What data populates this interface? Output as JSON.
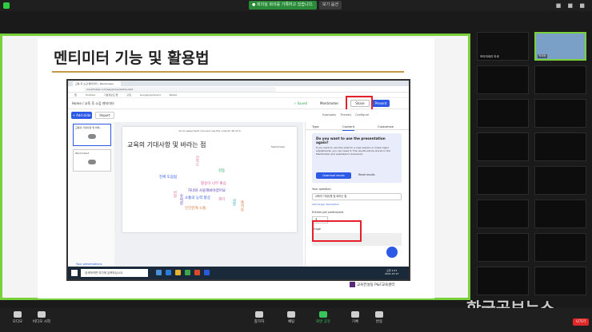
{
  "zoom": {
    "recording_badge": "● 회의실 회의를 기록하고 있습니다.",
    "view_option": "보기 옵션",
    "top_right_icons": "■ ■ ■"
  },
  "slide": {
    "title": "멘티미터 기능 및 활용법",
    "logo_text": "교육컨설팅 P&F교육센터"
  },
  "browser": {
    "tab": "교육 후 소감 멘티미터 - Mentimeter",
    "url": "mentimeter.com/app/presentation/edit",
    "bookmarks": [
      "앱",
      "YouTube",
      "기본정보요·앱",
      "구글",
      "Google Jamboard",
      "Padlet"
    ]
  },
  "menti": {
    "breadcrumb": "Home / 교육 후 소감 멘티미터",
    "saved": "✓ Saved",
    "logo": "Mentimeter",
    "share": "Share",
    "present": "Present",
    "add_slide": "+ Add slide",
    "import": "Import",
    "toolbar_right": "Examples Themes Configure",
    "thumbs": [
      {
        "num": "1",
        "label": "교육의 기대사항 및 바라..."
      },
      {
        "num": "2",
        "label": "Word Cloud"
      }
    ],
    "your_presentations": "Your presentations",
    "instruction": "Go to www.menti.com and use the code 22 36 24 4",
    "question_title": "교육의 기대사항 및 바라는 점",
    "brand": "Mentimeter",
    "words": [
      "만족도",
      "진짜 도움됨",
      "활용이 너무 좋음",
      "자녀와 사용해봐야겠어요",
      "소통의 능력 향상",
      "인간관계 소통",
      "재미",
      "감동",
      "즐거움",
      "변화",
      "성장",
      "유익함"
    ],
    "panel_tabs": [
      "Type",
      "Content",
      "Customize"
    ],
    "promo_title": "Do you want to use the presentation again?",
    "promo_body": "If you want to use this slide for a new session or make major adjustments, you can reset it. The results will be stored in the Mentimeter and available to download.",
    "download_btn": "Download results",
    "more_btn": "Reset results",
    "question_label": "Your question",
    "question_value": "교육의 기대사항 및 바라는 점",
    "long_desc": "Add longer description",
    "entries_label": "Entries per participant",
    "entries_value": "3",
    "image_label": "Image"
  },
  "taskbar": {
    "search": "검색하려면 여기에 입력하십시오.",
    "time": "오후 2:47",
    "date": "2021-07-27"
  },
  "gallery": {
    "tiles": [
      {
        "name": "보라미세리 미세",
        "text": "",
        "color": "#101010"
      },
      {
        "name": "박태현",
        "text": "",
        "color": "#7aa0c8"
      },
      {
        "name": "",
        "text": "",
        "color": "#0d0d0d"
      },
      {
        "name": "",
        "text": "",
        "color": "#0d0d0d"
      },
      {
        "name": "",
        "text": "",
        "color": "#0d0d0d"
      },
      {
        "name": "",
        "text": "",
        "color": "#0d0d0d"
      },
      {
        "name": "",
        "text": "",
        "color": "#0d0d0d"
      },
      {
        "name": "",
        "text": "",
        "color": "#0d0d0d"
      },
      {
        "name": "",
        "text": "",
        "color": "#0d0d0d"
      },
      {
        "name": "",
        "text": "",
        "color": "#0d0d0d"
      },
      {
        "name": "",
        "text": "",
        "color": "#0d0d0d"
      },
      {
        "name": "",
        "text": "",
        "color": "#0d0d0d"
      },
      {
        "name": "",
        "text": "",
        "color": "#0d0d0d"
      },
      {
        "name": "",
        "text": "",
        "color": "#0d0d0d"
      },
      {
        "name": "",
        "text": "",
        "color": "#0d0d0d"
      },
      {
        "name": "",
        "text": "",
        "color": "#0d0d0d"
      }
    ]
  },
  "watermark": "한국공보뉴스",
  "bottom_bar": {
    "items": [
      {
        "label": "오디오",
        "green": false
      },
      {
        "label": "비디오 시작",
        "green": false
      },
      {
        "label": "참가자",
        "green": false
      },
      {
        "label": "채팅",
        "green": false
      },
      {
        "label": "화면 공유",
        "green": true
      },
      {
        "label": "기록",
        "green": false
      },
      {
        "label": "반응",
        "green": false
      }
    ],
    "exit": "나가기"
  }
}
